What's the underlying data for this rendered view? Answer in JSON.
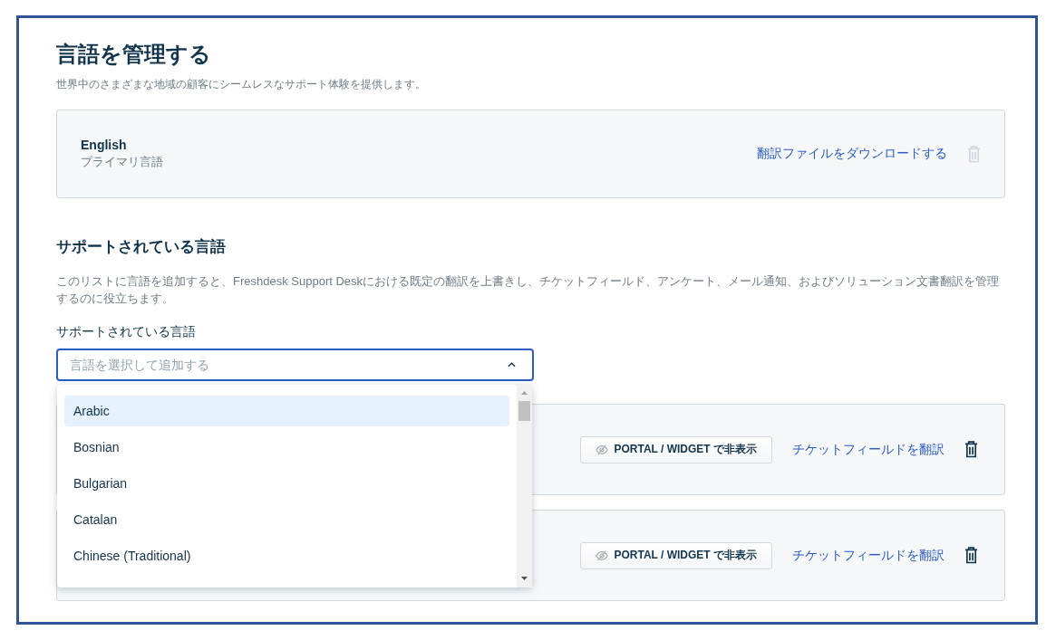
{
  "title": "言語を管理する",
  "subtitle": "世界中のさまざまな地域の顧客にシームレスなサポート体験を提供します。",
  "primary": {
    "name": "English",
    "caption": "プライマリ言語",
    "link": "翻訳ファイルをダウンロードする",
    "delete_disabled": true
  },
  "supported": {
    "heading": "サポートされている言語",
    "description": "このリストに言語を追加すると、Freshdesk Support Deskにおける既定の翻訳を上書きし、チケットフィールド、アンケート、メール通知、およびソリューション文書翻訳を管理するのに役立ちます。",
    "field_label": "サポートされている言語",
    "placeholder": "言語を選択して追加する",
    "expanded": true
  },
  "dropdown_options": [
    {
      "label": "Arabic",
      "selected": true
    },
    {
      "label": "Bosnian",
      "selected": false
    },
    {
      "label": "Bulgarian",
      "selected": false
    },
    {
      "label": "Catalan",
      "selected": false
    },
    {
      "label": "Chinese (Traditional)",
      "selected": false
    }
  ],
  "languages": [
    {
      "hide_button": "PORTAL / WIDGET で非表示",
      "link": "チケットフィールドを翻訳",
      "delete_disabled": false
    },
    {
      "hide_button": "PORTAL / WIDGET で非表示",
      "link": "チケットフィールドを翻訳",
      "delete_disabled": false
    }
  ]
}
